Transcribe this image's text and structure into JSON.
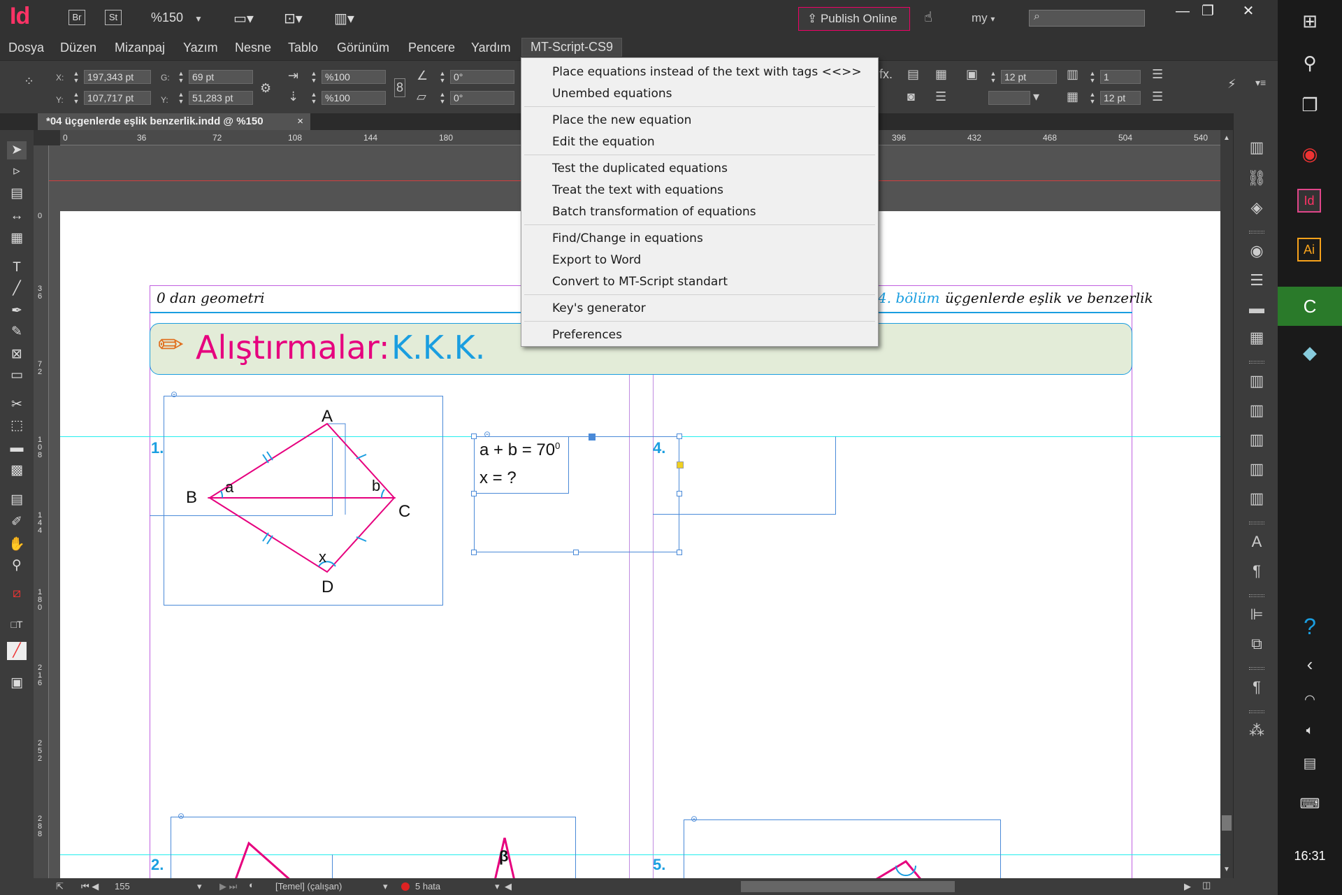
{
  "app": {
    "logo": "Id",
    "br": "Br",
    "st": "St",
    "zoom": "%150",
    "publish": "Publish Online",
    "workspace": "my"
  },
  "menu": [
    "Dosya",
    "Düzen",
    "Mizanpaj",
    "Yazım",
    "Nesne",
    "Tablo",
    "Görünüm",
    "Pencere",
    "Yardım",
    "MT-Script-CS9"
  ],
  "control": {
    "x_label": "X:",
    "x": "197,343 pt",
    "y_label": "Y:",
    "y": "107,717 pt",
    "g_label": "G:",
    "g": "69 pt",
    "y2_label": "Y:",
    "y2": "51,283 pt",
    "scale_x": "%100",
    "scale_y": "%100",
    "rot": "0°",
    "shear": "0°",
    "stroke": "12 pt",
    "cols": "1",
    "gutter": "12 pt"
  },
  "tab": {
    "title": "*04 üçgenlerde eşlik benzerlik.indd @ %150",
    "close": "×"
  },
  "ruler": [
    "0",
    "36",
    "72",
    "108",
    "144",
    "180",
    "396",
    "432",
    "468",
    "504",
    "540"
  ],
  "vruler": [
    "0",
    "3 6",
    "7 2",
    "1 0 8",
    "1 4 4",
    "1 8 0",
    "2 1 6",
    "2 5 2",
    "2 8 8"
  ],
  "dropdown": {
    "groups": [
      [
        "Place equations instead of the text with tags <<>>",
        "Unembed equations"
      ],
      [
        "Place the new equation",
        "Edit the equation"
      ],
      [
        "Test the duplicated equations",
        "Treat the text with equations",
        "Batch transformation of equations"
      ],
      [
        "Find/Change in equations",
        "Export to Word",
        "Convert to MT-Script standart"
      ],
      [
        "Key's generator"
      ],
      [
        "Preferences"
      ]
    ]
  },
  "document": {
    "header_left": "0 dan geometri",
    "header_chapter": "4. bölüm",
    "header_right": "üçgenlerde eşlik ve benzerlik",
    "exercise_word": "Alıştırmalar:",
    "exercise_code": "K.K.K.",
    "q1": "1.",
    "q2": "2.",
    "q4": "4.",
    "q5": "5.",
    "points": {
      "A": "A",
      "B": "B",
      "C": "C",
      "D": "D",
      "a": "a",
      "b": "b",
      "x": "x"
    },
    "eq1": "a + b = 70",
    "eq1_sup": "0",
    "eq2": "x = ?",
    "beta": "β"
  },
  "status": {
    "page": "155",
    "style": "[Temel] (çalışan)",
    "errors": "5 hata"
  },
  "taskbar": {
    "time": "16:31"
  },
  "colors": {
    "accent_pink": "#e6007e",
    "accent_blue": "#1a9ee0",
    "guide_cyan": "#22e6e6",
    "margin_purple": "#c060e0",
    "banner_bg": "#e3ecd8"
  }
}
